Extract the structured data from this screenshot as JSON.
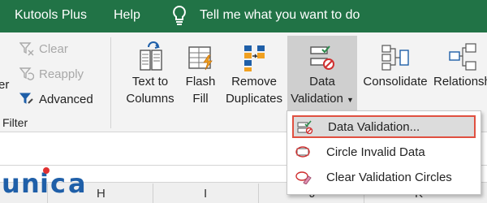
{
  "tabs": {
    "kutools_plus": "Kutools Plus",
    "help": "Help",
    "tell_me": "Tell me what you want to do"
  },
  "sort_filter": {
    "partial_label": "er",
    "clear": "Clear",
    "reapply": "Reapply",
    "advanced": "Advanced",
    "group_label": "Filter"
  },
  "data_tools": {
    "text_to_columns": [
      "Text to",
      "Columns"
    ],
    "flash_fill": [
      "Flash",
      "Fill"
    ],
    "remove_duplicates": [
      "Remove",
      "Duplicates"
    ],
    "data_validation": [
      "Data",
      "Validation"
    ],
    "consolidate": "Consolidate",
    "relationships": "Relationsh"
  },
  "dropdown": {
    "items": [
      "Data Validation...",
      "Circle Invalid Data",
      "Clear Validation Circles"
    ],
    "selected": "Data Validation..."
  },
  "columns": [
    "H",
    "I",
    "J",
    "K"
  ],
  "watermark": "unica",
  "colors": {
    "ribbon_tab_bg": "#217346",
    "ribbon_bg": "#f3f3f3",
    "highlight_border": "#e05040",
    "watermark_blue": "#1f5fa8"
  }
}
